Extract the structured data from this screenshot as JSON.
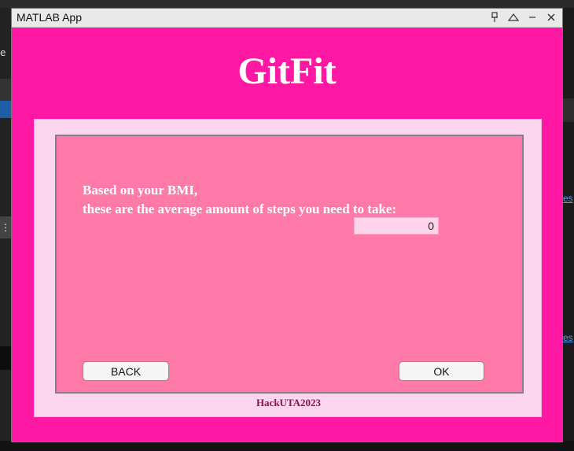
{
  "window": {
    "title": "MATLAB App",
    "controls": [
      "pin-icon",
      "minimize-panel-icon",
      "minimize-icon",
      "close-icon"
    ]
  },
  "app": {
    "title": "GitFit",
    "message_line1": "Based on your BMI,",
    "message_line2": "these are the average amount of steps you need to take:",
    "steps_value": "0",
    "back_label": "BACK",
    "ok_label": "OK",
    "footer": "HackUTA2023"
  },
  "background": {
    "left_letter": "e",
    "right_link_fragment_1": "es",
    "right_link_fragment_2": "es"
  },
  "colors": {
    "window_bg": "#ff18a3",
    "outer_panel": "#fbd6ee",
    "inner_panel": "#ff7aa8",
    "footer_text": "#8b1447"
  }
}
